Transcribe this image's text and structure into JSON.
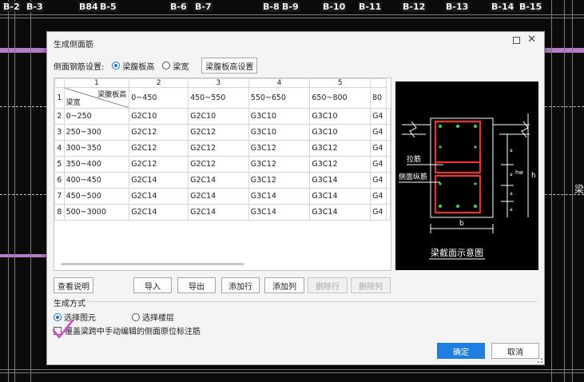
{
  "cad": {
    "axis_labels": [
      "B-2",
      "B-3",
      "B84",
      "B-5",
      "B-6",
      "B-7",
      "B-8",
      "B-9",
      "B-10",
      "B-11",
      "B-12",
      "B-13",
      "B-14",
      "B-15"
    ],
    "side_text": "梁"
  },
  "dialog": {
    "title": "生成侧面筋",
    "settings_label": "侧面钢筋设置:",
    "radio_options": [
      {
        "label": "梁腹板高",
        "selected": true
      },
      {
        "label": "梁宽",
        "selected": false
      }
    ],
    "settings_button": "梁腹板高设置"
  },
  "table": {
    "column_numbers": [
      "1",
      "2",
      "3",
      "4",
      "5"
    ],
    "header_top_right": "梁腹板高",
    "header_bottom_left": "梁宽",
    "column_headers": [
      "0~450",
      "450~550",
      "550~650",
      "650~800",
      "80"
    ],
    "rows": [
      {
        "num": "2",
        "width": "0~250",
        "cells": [
          "G2C10",
          "G2C10",
          "G3C10",
          "G3C10",
          "G4"
        ]
      },
      {
        "num": "3",
        "width": "250~300",
        "cells": [
          "G2C12",
          "G2C12",
          "G3C10",
          "G3C10",
          "G4"
        ]
      },
      {
        "num": "4",
        "width": "300~350",
        "cells": [
          "G2C12",
          "G2C12",
          "G3C12",
          "G3C12",
          "G4"
        ]
      },
      {
        "num": "5",
        "width": "350~400",
        "cells": [
          "G2C12",
          "G2C12",
          "G3C12",
          "G3C12",
          "G4"
        ]
      },
      {
        "num": "6",
        "width": "400~450",
        "cells": [
          "G2C14",
          "G2C14",
          "G3C12",
          "G3C14",
          "G4"
        ]
      },
      {
        "num": "7",
        "width": "450~500",
        "cells": [
          "G2C14",
          "G2C14",
          "G3C14",
          "G3C14",
          "G4"
        ]
      },
      {
        "num": "8",
        "width": "500~3000",
        "cells": [
          "G2C14",
          "G2C14",
          "G3C14",
          "G3C14",
          "G4"
        ]
      }
    ],
    "header_row_num": "1"
  },
  "preview": {
    "label_tie": "拉筋",
    "label_side": "侧面纵筋",
    "label_b": "b",
    "label_h": "h",
    "label_hw": "hw",
    "label_a": "a",
    "caption": "梁截面示意图",
    "colors": {
      "rebar": "#ff2a2a",
      "dots": "#2fe04a",
      "lines": "#ffffff"
    }
  },
  "actions": {
    "help": "查看说明",
    "import": "导入",
    "export": "导出",
    "add_row": "添加行",
    "add_col": "添加列",
    "del_row": "删除行",
    "del_col": "删除列"
  },
  "generation": {
    "label": "生成方式",
    "options": [
      {
        "label": "选择图元",
        "selected": true
      },
      {
        "label": "选择楼层",
        "selected": false
      }
    ],
    "checkbox_label": "覆盖梁跨中手动编辑的侧面原位标注筋",
    "checkbox_checked": false
  },
  "buttons": {
    "ok": "确定",
    "cancel": "取消"
  },
  "colors": {
    "primary": "#1f7ee0",
    "annotation_check": "#e03fd0"
  }
}
